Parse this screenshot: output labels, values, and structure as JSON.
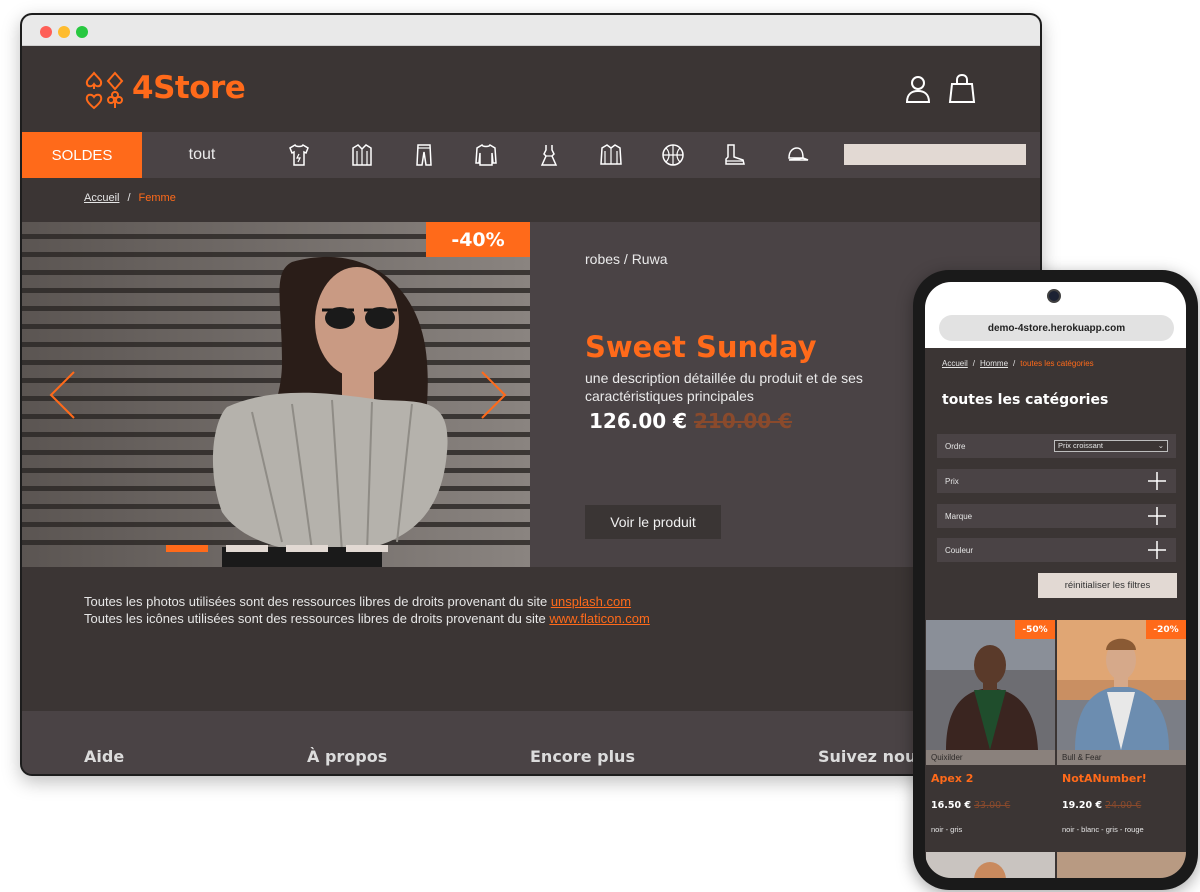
{
  "desktop": {
    "brand": "4Store",
    "nav": {
      "soldes": "SOLDES",
      "tout": "tout"
    },
    "categories": [
      "t-shirt-icon",
      "shirt-icon",
      "pants-icon",
      "sweater-icon",
      "dress-icon",
      "jacket-icon",
      "basketball-icon",
      "boot-icon",
      "cap-icon"
    ],
    "breadcrumb": {
      "home": "Accueil",
      "current": "Femme"
    },
    "hero": {
      "discount": "-40%",
      "category": "robes / Ruwa",
      "title": "Sweet Sunday",
      "description": "une description détaillée du produit et de ses caractéristiques principales",
      "price": "126.00 €",
      "old_price": "210.00 €",
      "cta": "Voir le produit",
      "slide_count": 4,
      "active_slide": 1
    },
    "credits": {
      "line1_prefix": "Toutes les photos utilisées sont des ressources libres de droits provenant du site ",
      "line1_link": "unsplash.com",
      "line2_prefix": "Toutes les icônes utilisées sont des ressources libres de droits provenant du site ",
      "line2_link": "www.flaticon.com"
    },
    "footer": {
      "col1": "Aide",
      "col2": "À propos",
      "col3": "Encore plus",
      "col4": "Suivez nous"
    }
  },
  "mobile": {
    "url": "demo-4store.herokuapp.com",
    "breadcrumb": {
      "home": "Accueil",
      "second": "Homme",
      "current": "toutes les catégories"
    },
    "title": "toutes les catégories",
    "filters": {
      "order_label": "Ordre",
      "order_value": "Prix croissant",
      "price_label": "Prix",
      "brand_label": "Marque",
      "color_label": "Couleur",
      "reset": "réinitialiser les filtres"
    },
    "products": [
      {
        "discount": "-50%",
        "brand": "Quixilder",
        "name": "Apex 2",
        "price": "16.50 €",
        "old_price": "33.00 €",
        "colors": "noir - gris"
      },
      {
        "discount": "-20%",
        "brand": "Bull & Fear",
        "name": "NotANumber!",
        "price": "19.20 €",
        "old_price": "24.00 €",
        "colors": "noir - blanc - gris - rouge"
      }
    ]
  },
  "colors": {
    "accent": "#ff6a1a",
    "background": "#3b3534",
    "panel": "#4a4345"
  }
}
